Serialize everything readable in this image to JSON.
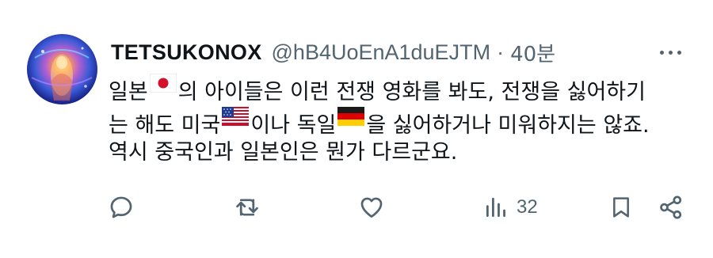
{
  "post": {
    "display_name": "TETSUKONOX",
    "handle": "@hB4UoEnA1duEJTM",
    "separator": "·",
    "time": "40분",
    "text": {
      "l1_a": "일본",
      "l1_b": "의 아이들은 이런 전쟁 영화를 봐도, 전쟁을 싫어하기",
      "l2_a": "는 해도 미국",
      "l2_b": "이나 독일",
      "l2_c": "을 싫어하거나 미워하지는 않죠.",
      "l3": "역시 중국인과 일본인은 뭔가 다르군요."
    },
    "flags": [
      "japan-flag-emoji",
      "usa-flag-emoji",
      "germany-flag-emoji"
    ]
  },
  "actions": {
    "views_count": "32"
  },
  "colors": {
    "text": "#0f1419",
    "muted": "#536471",
    "background": "#ffffff"
  }
}
